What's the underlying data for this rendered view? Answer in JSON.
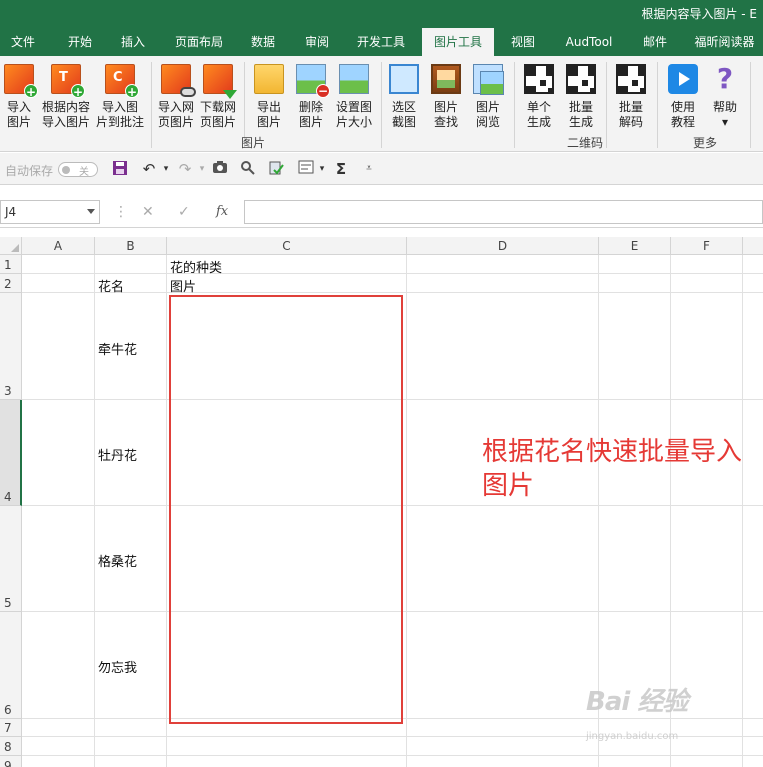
{
  "window": {
    "title": "根据内容导入图片 - E"
  },
  "tabs": [
    {
      "label": "文件"
    },
    {
      "label": "开始"
    },
    {
      "label": "插入"
    },
    {
      "label": "页面布局"
    },
    {
      "label": "数据"
    },
    {
      "label": "审阅"
    },
    {
      "label": "开发工具"
    },
    {
      "label": "图片工具"
    },
    {
      "label": "视图"
    },
    {
      "label": "AudTool"
    },
    {
      "label": "邮件"
    },
    {
      "label": "福昕阅读器"
    }
  ],
  "active_tab": "图片工具",
  "ribbon": {
    "buttons": [
      {
        "line1": "导入",
        "line2": "图片",
        "icon": "image-add-icon"
      },
      {
        "line1": "根据内容",
        "line2": "导入图片",
        "icon": "image-by-content-icon"
      },
      {
        "line1": "导入图",
        "line2": "片到批注",
        "icon": "image-to-comment-icon"
      },
      {
        "line1": "导入网",
        "line2": "页图片",
        "icon": "web-image-link-icon"
      },
      {
        "line1": "下载网",
        "line2": "页图片",
        "icon": "web-image-download-icon"
      },
      {
        "line1": "导出",
        "line2": "图片",
        "icon": "folder-export-icon"
      },
      {
        "line1": "删除",
        "line2": "图片",
        "icon": "image-delete-icon"
      },
      {
        "line1": "设置图",
        "line2": "片大小",
        "icon": "image-resize-icon"
      },
      {
        "line1": "选区",
        "line2": "截图",
        "icon": "selection-screenshot-icon"
      },
      {
        "line1": "图片",
        "line2": "查找",
        "icon": "image-find-icon"
      },
      {
        "line1": "图片",
        "line2": "阅览",
        "icon": "image-browse-icon"
      },
      {
        "line1": "单个",
        "line2": "生成",
        "icon": "qr-single-icon"
      },
      {
        "line1": "批量",
        "line2": "生成",
        "icon": "qr-batch-icon"
      },
      {
        "line1": "批量",
        "line2": "解码",
        "icon": "qr-decode-icon"
      },
      {
        "line1": "使用",
        "line2": "教程",
        "icon": "play-tutorial-icon"
      },
      {
        "line1": "帮助",
        "line2": "▾",
        "icon": "help-icon"
      }
    ],
    "groups": {
      "images": "图片",
      "qrcode": "二维码",
      "more": "更多"
    }
  },
  "qat": {
    "autosave_label": "自动保存",
    "toggle_state": "关",
    "sum_symbol": "Σ"
  },
  "formula_bar": {
    "name_box": "J4",
    "fx": "fx",
    "value": ""
  },
  "sheet": {
    "columns": [
      "A",
      "B",
      "C",
      "D",
      "E",
      "F"
    ],
    "rows": [
      "1",
      "2",
      "3",
      "4",
      "5",
      "6",
      "7",
      "8",
      "9"
    ],
    "cells": {
      "C1": "花的种类",
      "B2": "花名",
      "C2": "图片",
      "B3": "牵牛花",
      "B4": "牡丹花",
      "B5": "格桑花",
      "B6": "勿忘我"
    },
    "selected_row": "4"
  },
  "annotation": {
    "text": "根据花名快速批量导入图片",
    "color": "#e53935"
  },
  "watermark": {
    "brand": "Bai 经验",
    "url": "jingyan.baidu.com"
  },
  "colors": {
    "accent": "#217346",
    "highlight_box": "#e0403a"
  }
}
